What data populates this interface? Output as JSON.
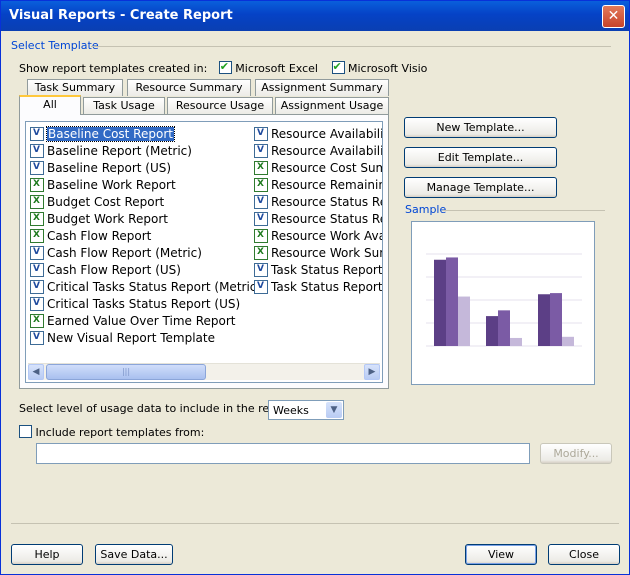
{
  "window": {
    "title": "Visual Reports - Create Report",
    "close_glyph": "✕"
  },
  "template_section": {
    "label": "Select Template"
  },
  "created_in": {
    "label": "Show report templates created in:",
    "excel": {
      "label": "Microsoft Excel",
      "checked": true
    },
    "visio": {
      "label": "Microsoft Visio",
      "checked": true
    }
  },
  "tabs_back": [
    "Task Summary",
    "Resource Summary",
    "Assignment Summary"
  ],
  "tabs_front": [
    "All",
    "Task Usage",
    "Resource Usage",
    "Assignment Usage"
  ],
  "active_tab": "All",
  "templates_col1": [
    {
      "label": "Baseline Cost Report",
      "icon": "visio-icon",
      "selected": true
    },
    {
      "label": "Baseline Report (Metric)",
      "icon": "visio-icon"
    },
    {
      "label": "Baseline Report (US)",
      "icon": "visio-icon"
    },
    {
      "label": "Baseline Work Report",
      "icon": "excel-icon"
    },
    {
      "label": "Budget Cost Report",
      "icon": "excel-icon"
    },
    {
      "label": "Budget Work Report",
      "icon": "excel-icon"
    },
    {
      "label": "Cash Flow Report",
      "icon": "excel-icon"
    },
    {
      "label": "Cash Flow Report (Metric)",
      "icon": "visio-icon"
    },
    {
      "label": "Cash Flow Report (US)",
      "icon": "visio-icon"
    },
    {
      "label": "Critical Tasks Status Report (Metric)",
      "icon": "visio-icon"
    },
    {
      "label": "Critical Tasks Status Report (US)",
      "icon": "visio-icon"
    },
    {
      "label": "Earned Value Over Time Report",
      "icon": "excel-icon"
    },
    {
      "label": "New Visual Report Template",
      "icon": "visio-icon"
    }
  ],
  "templates_col2": [
    {
      "label": "Resource Availability",
      "icon": "visio-icon"
    },
    {
      "label": "Resource Availability",
      "icon": "visio-icon"
    },
    {
      "label": "Resource Cost Summ",
      "icon": "excel-icon"
    },
    {
      "label": "Resource Remaining",
      "icon": "excel-icon"
    },
    {
      "label": "Resource Status Rep",
      "icon": "visio-icon"
    },
    {
      "label": "Resource Status Rep",
      "icon": "visio-icon"
    },
    {
      "label": "Resource Work Avai",
      "icon": "excel-icon"
    },
    {
      "label": "Resource Work Sum",
      "icon": "excel-icon"
    },
    {
      "label": "Task Status Report",
      "icon": "visio-icon"
    },
    {
      "label": "Task Status Report",
      "icon": "visio-icon"
    }
  ],
  "side_buttons": {
    "new": "New Template...",
    "edit": "Edit Template...",
    "manage": "Manage Template..."
  },
  "sample": {
    "label": "Sample",
    "bar_groups": [
      [
        0.75,
        0.77,
        0.43
      ],
      [
        0.26,
        0.31,
        0.07
      ],
      [
        0.45,
        0.46,
        0.08
      ]
    ],
    "colors": [
      "#5c3f86",
      "#7b5ba5",
      "#c5b8da"
    ]
  },
  "usage": {
    "label": "Select level of usage data to include in the report:",
    "value": "Weeks"
  },
  "include": {
    "label": "Include report templates from:",
    "checked": false,
    "path_value": "",
    "modify": "Modify..."
  },
  "footer": {
    "help": "Help",
    "save_data": "Save Data...",
    "view": "View",
    "close": "Close"
  }
}
